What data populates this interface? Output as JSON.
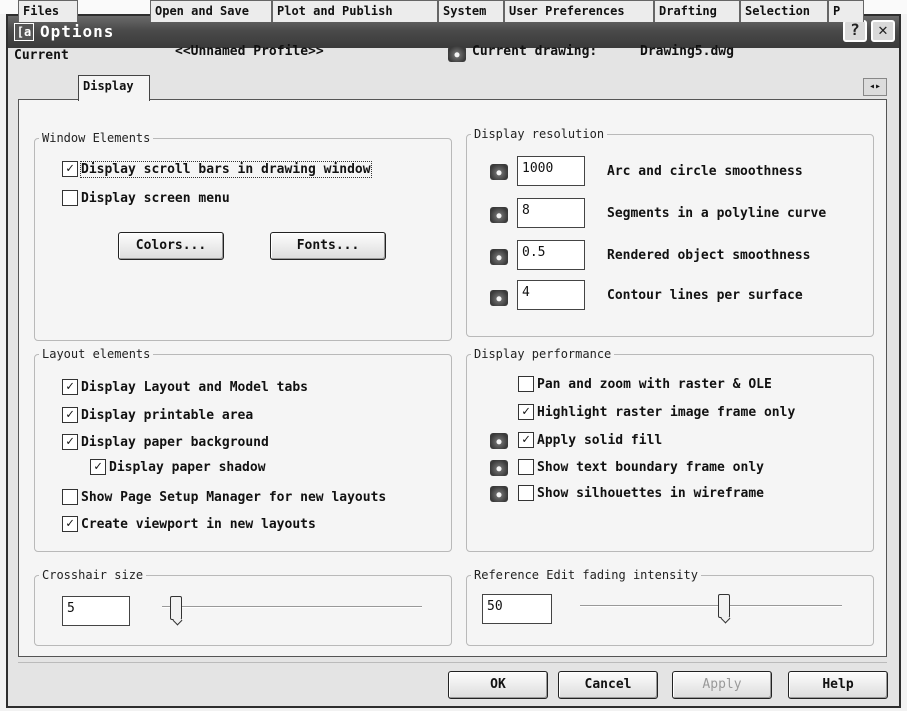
{
  "window": {
    "title": "Options",
    "icon": "app-icon-glyph",
    "icon_text": "[a"
  },
  "profile": {
    "label": "Current",
    "name": "<<Unnamed Profile>>",
    "drawing_label": "Current drawing:",
    "drawing_name": "Drawing5.dwg"
  },
  "tabs": [
    {
      "label": "Files",
      "active": false
    },
    {
      "label": "Display",
      "active": true
    },
    {
      "label": "Open and Save",
      "active": false
    },
    {
      "label": "Plot and Publish",
      "active": false
    },
    {
      "label": "System",
      "active": false
    },
    {
      "label": "User Preferences",
      "active": false
    },
    {
      "label": "Drafting",
      "active": false
    },
    {
      "label": "Selection",
      "active": false
    },
    {
      "label": "P",
      "active": false
    }
  ],
  "tab_scroll": "◂▸",
  "window_elements": {
    "legend": "Window Elements",
    "scroll_bars": {
      "label": "Display scroll bars in drawing window",
      "checked": true
    },
    "screen_menu": {
      "label": "Display screen menu",
      "checked": false
    },
    "colors_button": "Colors...",
    "fonts_button": "Fonts..."
  },
  "layout_elements": {
    "legend": "Layout elements",
    "items": [
      {
        "label": "Display Layout and Model tabs",
        "checked": true
      },
      {
        "label": "Display printable area",
        "checked": true
      },
      {
        "label": "Display paper background",
        "checked": true
      },
      {
        "label": "Display paper shadow",
        "checked": true
      },
      {
        "label": "Show Page Setup Manager for new layouts",
        "checked": false
      },
      {
        "label": "Create viewport in new layouts",
        "checked": true
      }
    ]
  },
  "crosshair": {
    "legend": "Crosshair size",
    "value": "5",
    "slider_fraction": 0.05
  },
  "display_resolution": {
    "legend": "Display resolution",
    "items": [
      {
        "value": "1000",
        "label": "Arc and circle smoothness"
      },
      {
        "value": "8",
        "label": "Segments in a polyline curve"
      },
      {
        "value": "0.5",
        "label": "Rendered object smoothness"
      },
      {
        "value": "4",
        "label": "Contour lines per surface"
      }
    ]
  },
  "display_performance": {
    "legend": "Display performance",
    "items": [
      {
        "label": "Pan and zoom with raster & OLE",
        "checked": false,
        "icon": false
      },
      {
        "label": "Highlight raster image frame only",
        "checked": true,
        "icon": false
      },
      {
        "label": "Apply solid fill",
        "checked": true,
        "icon": true
      },
      {
        "label": "Show text boundary frame only",
        "checked": false,
        "icon": true
      },
      {
        "label": "Show silhouettes in wireframe",
        "checked": false,
        "icon": true
      }
    ]
  },
  "reference_edit": {
    "legend": "Reference Edit fading intensity",
    "value": "50",
    "slider_fraction": 0.5
  },
  "footer": {
    "ok": "OK",
    "cancel": "Cancel",
    "apply": "Apply",
    "help": "Help"
  },
  "checkmark": "✓",
  "help_glyph": "?",
  "close_glyph": "✕"
}
